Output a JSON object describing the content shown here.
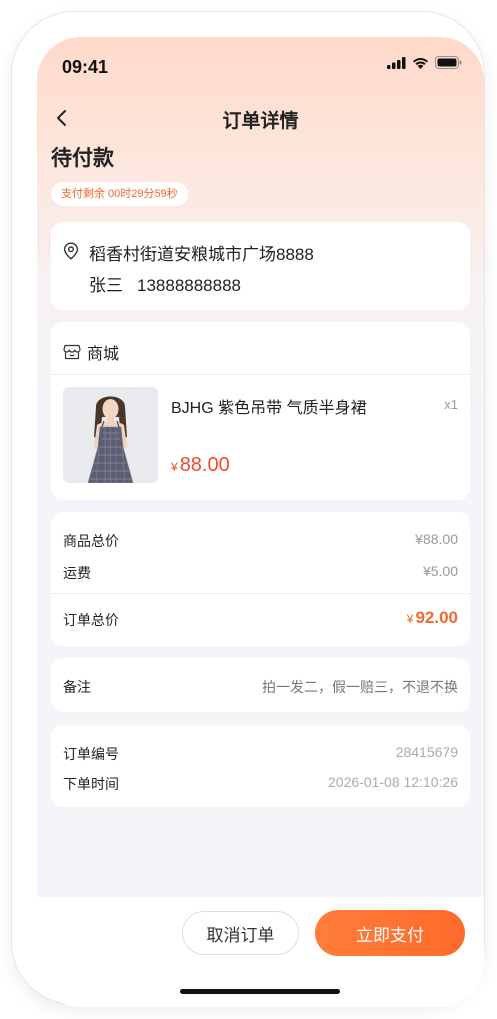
{
  "status_bar": {
    "time": "09:41",
    "icons": [
      "signal-icon",
      "wifi-icon",
      "battery-icon"
    ]
  },
  "nav": {
    "title": "订单详情",
    "back_icon": "chevron-left-icon"
  },
  "order": {
    "status": "待付款",
    "countdown": "支付剩余 00时29分59秒"
  },
  "address": {
    "icon": "location-pin-icon",
    "address": "稻香村街道安粮城市广场8888",
    "name": "张三",
    "phone": "13888888888"
  },
  "goods": {
    "shop_icon": "store-icon",
    "shop_name": "商城",
    "items": [
      {
        "name": "BJHG 紫色吊带 气质半身裙",
        "quantity": "x1",
        "currency": "¥",
        "price": "88.00"
      }
    ]
  },
  "price": {
    "goods_total_label": "商品总价",
    "goods_total_value": "¥88.00",
    "shipping_label": "运费",
    "shipping_value": "¥5.00",
    "order_total_label": "订单总价",
    "order_total_currency": "¥",
    "order_total_value": "92.00"
  },
  "remark": {
    "label": "备注",
    "value": "拍一发二，假一赔三，不退不换"
  },
  "info": {
    "order_no_label": "订单编号",
    "order_no_value": "28415679",
    "order_time_label": "下单时间",
    "order_time_value": "2026-01-08 12:10:26"
  },
  "actions": {
    "cancel_label": "取消订单",
    "pay_label": "立即支付"
  },
  "colors": {
    "accent": "#ff6a2a",
    "price_red": "#f24b2e",
    "countdown_orange": "#f26a2e",
    "header_gradient_top": "#ffd9c9",
    "page_background": "#f4f4f9"
  }
}
